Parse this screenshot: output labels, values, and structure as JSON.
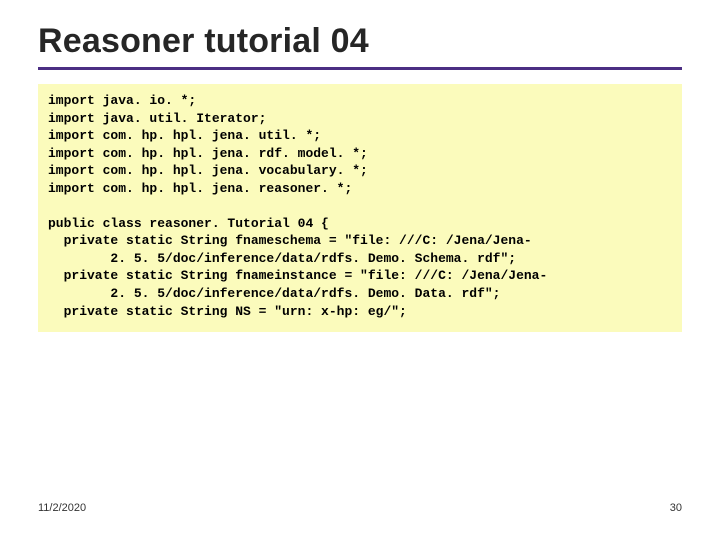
{
  "title": "Reasoner tutorial 04",
  "code": {
    "line1": "import java. io. *;",
    "line2": "import java. util. Iterator;",
    "line3": "import com. hp. hpl. jena. util. *;",
    "line4": "import com. hp. hpl. jena. rdf. model. *;",
    "line5": "import com. hp. hpl. jena. vocabulary. *;",
    "line6": "import com. hp. hpl. jena. reasoner. *;",
    "blank1": "",
    "line7": "public class reasoner. Tutorial 04 {",
    "line8": "  private static String fnameschema = \"file: ///C: /Jena/Jena-",
    "line9": "        2. 5. 5/doc/inference/data/rdfs. Demo. Schema. rdf\";",
    "line10": "  private static String fnameinstance = \"file: ///C: /Jena/Jena-",
    "line11": "        2. 5. 5/doc/inference/data/rdfs. Demo. Data. rdf\";",
    "line12": "  private static String NS = \"urn: x-hp: eg/\";"
  },
  "footer": {
    "date": "11/2/2020",
    "page": "30"
  }
}
